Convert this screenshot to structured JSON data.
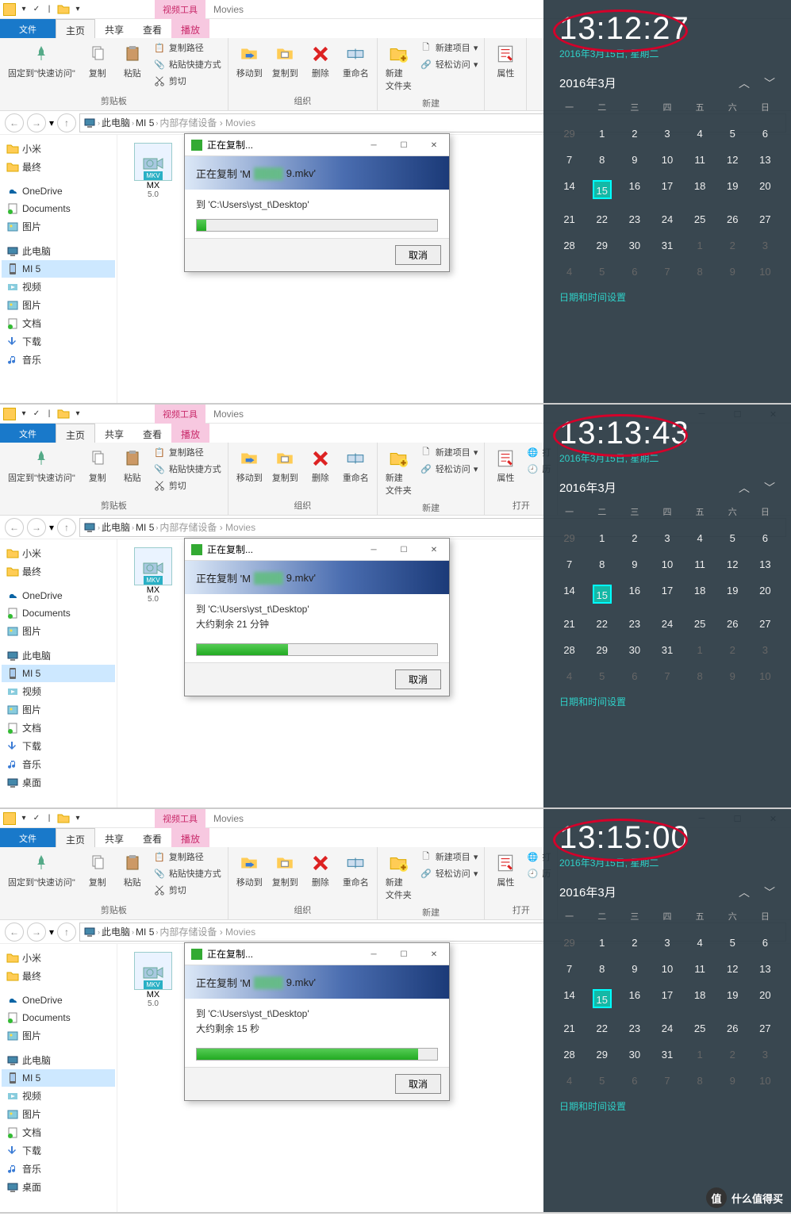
{
  "shots": [
    {
      "time": "13:12:27",
      "progress": 4,
      "eta": ""
    },
    {
      "time": "13:13:43",
      "progress": 38,
      "eta": "大约剩余 21 分钟"
    },
    {
      "time": "13:15:00",
      "progress": 92,
      "eta": "大约剩余 15 秒"
    }
  ],
  "titlebar": {
    "context_tab": "视频工具",
    "context_sub": "Movies"
  },
  "ribbon_tabs": {
    "file": "文件",
    "home": "主页",
    "share": "共享",
    "view": "查看",
    "play": "播放"
  },
  "ribbon": {
    "pin": "固定到\"快速访问\"",
    "copy": "复制",
    "paste": "粘贴",
    "copypath": "复制路径",
    "pasteshortcut": "粘贴快捷方式",
    "cut": "剪切",
    "clipboard": "剪贴板",
    "moveto": "移动到",
    "copyto": "复制到",
    "delete": "删除",
    "rename": "重命名",
    "organize": "组织",
    "newfolder": "新建\n文件夹",
    "newitem": "新建项目",
    "easyaccess": "轻松访问",
    "new": "新建",
    "properties": "属性",
    "open_lbl": "打",
    "open_group": "打开"
  },
  "breadcrumb": {
    "pc": "此电脑",
    "mi5": "MI 5",
    "more": "···"
  },
  "nav": {
    "xiaomi": "小米",
    "final": "最终",
    "onedrive": "OneDrive",
    "documents": "Documents",
    "pictures": "图片",
    "thispc": "此电脑",
    "mi5": "MI 5",
    "videos": "视频",
    "pics2": "图片",
    "docs2": "文档",
    "downloads": "下载",
    "music": "音乐",
    "desktop": "桌面"
  },
  "file": {
    "name": "MX",
    "ext": "MKV",
    "size": "5.0"
  },
  "dialog": {
    "title": "正在复制...",
    "heading_pre": "正在复制 'M",
    "heading_suf": "9.mkv'",
    "dest": "到 'C:\\Users\\yst_t\\Desktop'",
    "cancel": "取消"
  },
  "calendar": {
    "date_line": "2016年3月15日, 星期二",
    "month": "2016年3月",
    "dow": [
      "一",
      "二",
      "三",
      "四",
      "五",
      "六",
      "日"
    ],
    "prev": [
      29,
      1,
      2,
      3,
      4,
      5,
      6
    ],
    "rows": [
      [
        7,
        8,
        9,
        10,
        11,
        12,
        13
      ],
      [
        14,
        15,
        16,
        17,
        18,
        19,
        20
      ],
      [
        21,
        22,
        23,
        24,
        25,
        26,
        27
      ],
      [
        28,
        29,
        30,
        31,
        1,
        2,
        3
      ],
      [
        4,
        5,
        6,
        7,
        8,
        9,
        10
      ]
    ],
    "today": 15,
    "settings": "日期和时间设置"
  },
  "watermark": "什么值得买"
}
